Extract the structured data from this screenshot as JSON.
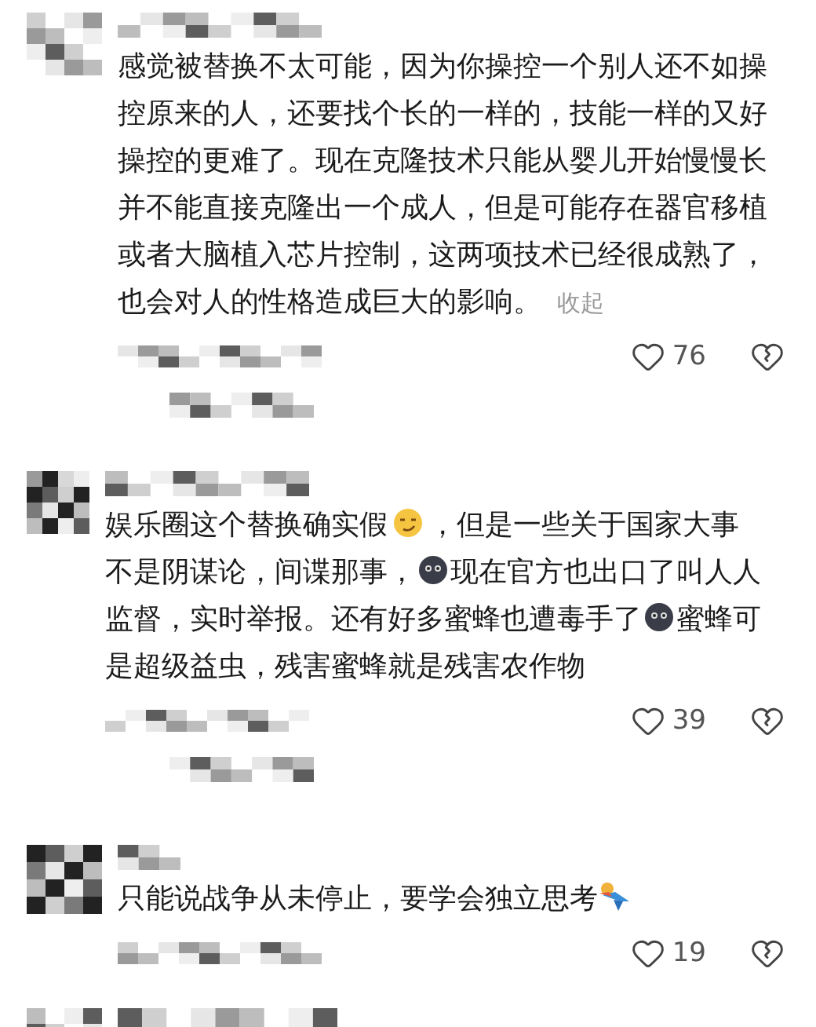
{
  "comments": [
    {
      "body": [
        {
          "kind": "text",
          "text": "感觉被替换不太可能，因为你操控一个别人还不如操控原来的人，还要找个长的一样的，技能一样的又好操控的更难了。现在克隆技术只能从婴儿开始慢慢长并不能直接克隆出一个成人，但是可能存在器官移植或者大脑植入芯片控制，这两项技术已经很成熟了，也会对人的性格造成巨大的影响。"
        }
      ],
      "collapse_link": "收起",
      "likes": "76"
    },
    {
      "body": [
        {
          "kind": "text",
          "text": "娱乐圈这个替换确实假"
        },
        {
          "kind": "smirk"
        },
        {
          "kind": "text",
          "text": "，但是一些关于国家大事不是阴谋论，间谍那事，"
        },
        {
          "kind": "moon"
        },
        {
          "kind": "text",
          "text": "现在官方也出口了叫人人监督，实时举报。还有好多蜜蜂也遭毒手了"
        },
        {
          "kind": "moon"
        },
        {
          "kind": "text",
          "text": "蜜蜂可是超级益虫，残害蜜蜂就是残害农作物"
        }
      ],
      "likes": "39"
    },
    {
      "body": [
        {
          "kind": "text",
          "text": "只能说战争从未停止，要学会独立思考"
        },
        {
          "kind": "figure"
        }
      ],
      "likes": "19"
    }
  ]
}
